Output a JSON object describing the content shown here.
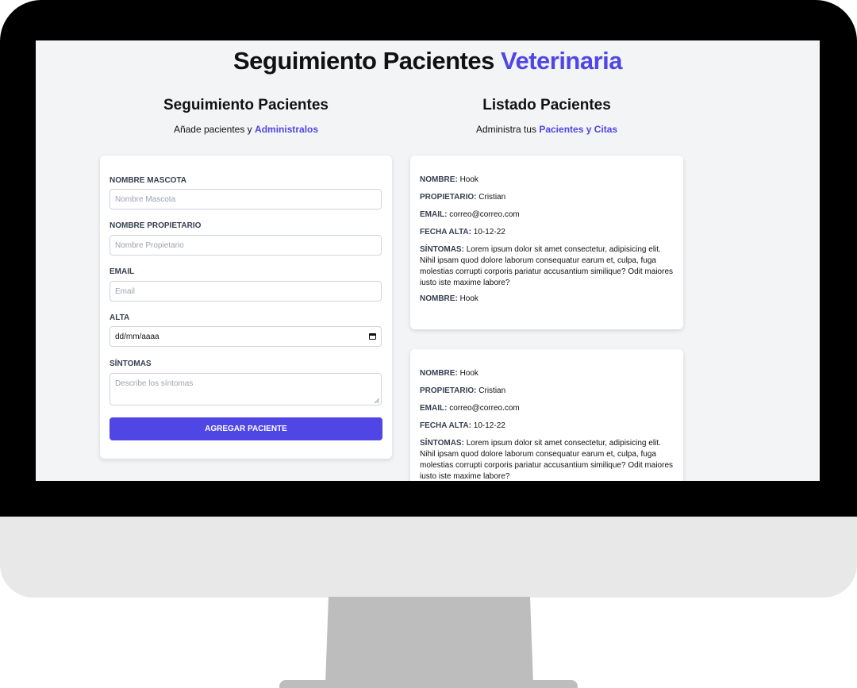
{
  "app": {
    "title_main": "Seguimiento Pacientes",
    "title_accent": "Veterinaria"
  },
  "form_column": {
    "heading": "Seguimiento Pacientes",
    "subtitle_text": "Añade pacientes y",
    "subtitle_link": "Administralos"
  },
  "list_column": {
    "heading": "Listado Pacientes",
    "subtitle_text": "Administra tus",
    "subtitle_link": "Pacientes y Citas"
  },
  "form": {
    "pet_label": "NOMBRE MASCOTA",
    "pet_placeholder": "Nombre Mascota",
    "owner_label": "NOMBRE PROPIETARIO",
    "owner_placeholder": "Nombre Propietario",
    "email_label": "EMAIL",
    "email_placeholder": "Email",
    "date_label": "ALTA",
    "date_value": "dd/mm/aaaa",
    "symptoms_label": "SÍNTOMAS",
    "symptoms_placeholder": "Describe los síntomas",
    "submit_label": "AGREGAR PACIENTE"
  },
  "patients": [
    {
      "name_label": "NOMBRE:",
      "name": "Hook",
      "owner_label": "PROPIETARIO:",
      "owner": "Cristian",
      "email_label": "EMAIL:",
      "email": "correo@correo.com",
      "date_label": "FECHA ALTA:",
      "date": "10-12-22",
      "symptoms_label": "SÍNTOMAS:",
      "symptoms": "Lorem ipsum dolor sit amet consectetur, adipisicing elit. Nihil ipsam quod dolore laborum consequatur earum et, culpa, fuga molestias corrupti corporis pariatur accusantium similique? Odit maiores iusto iste maxime labore?",
      "extra_label": "NOMBRE:",
      "extra": "Hook"
    },
    {
      "name_label": "NOMBRE:",
      "name": "Hook",
      "owner_label": "PROPIETARIO:",
      "owner": "Cristian",
      "email_label": "EMAIL:",
      "email": "correo@correo.com",
      "date_label": "FECHA ALTA:",
      "date": "10-12-22",
      "symptoms_label": "SÍNTOMAS:",
      "symptoms": "Lorem ipsum dolor sit amet consectetur, adipisicing elit. Nihil ipsam quod dolore laborum consequatur earum et, culpa, fuga molestias corrupti corporis pariatur accusantium similique? Odit maiores iusto iste maxime labore?"
    }
  ],
  "colors": {
    "accent": "#4f46e5",
    "screen_bg": "#f3f4f6",
    "bezel": "#000000",
    "chin": "#e8e8e8",
    "stand": "#bdbdbd"
  }
}
